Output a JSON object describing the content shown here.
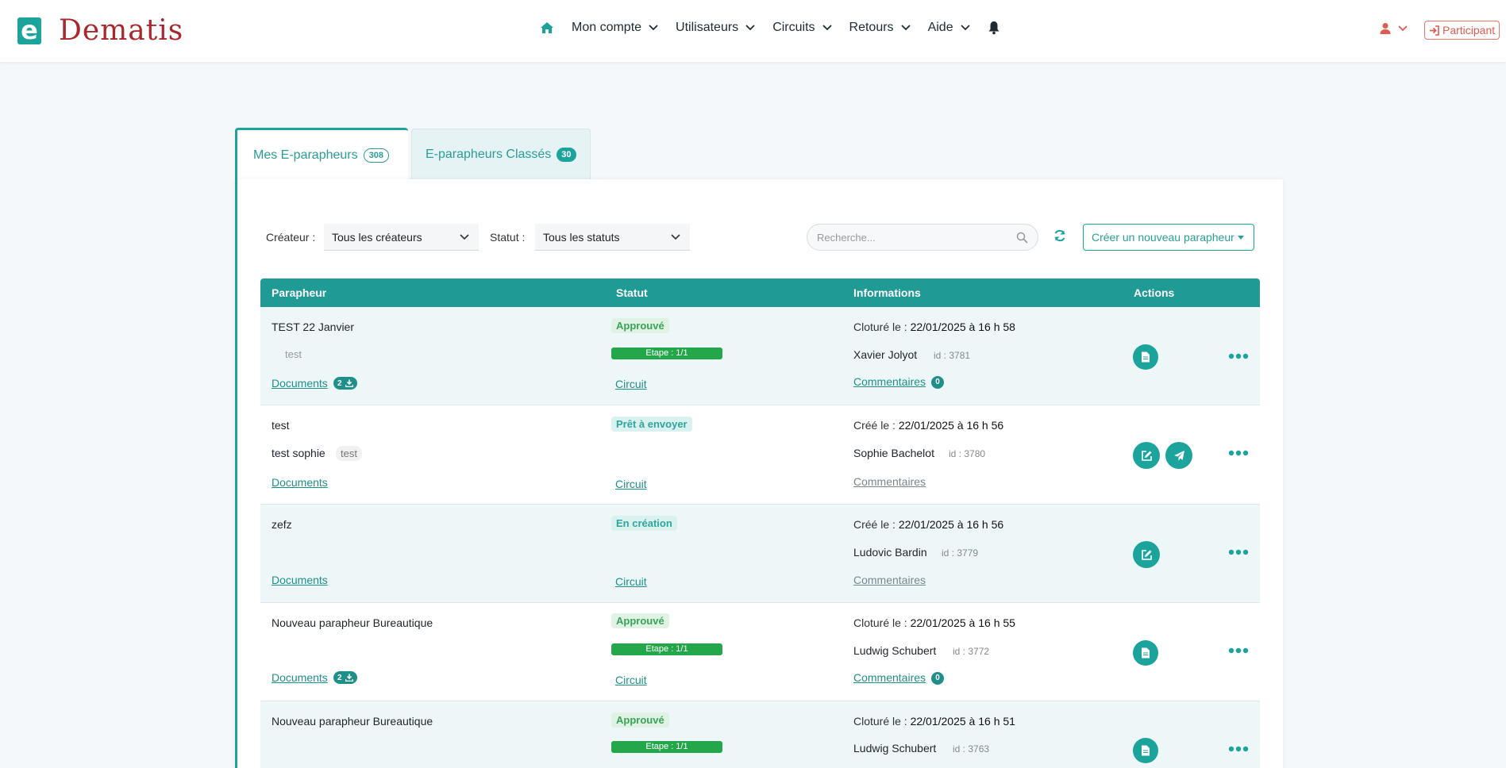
{
  "brand": {
    "logo_letter": "e",
    "name": "Dematis",
    "colors": {
      "primary": "#1ba39c",
      "brand_red": "#a8282e",
      "accent_orange": "#e05a4f"
    }
  },
  "nav": {
    "home_icon": "home-icon",
    "items": [
      {
        "label": "Mon compte"
      },
      {
        "label": "Utilisateurs"
      },
      {
        "label": "Circuits"
      },
      {
        "label": "Retours"
      },
      {
        "label": "Aide"
      }
    ],
    "bell_icon": "bell-icon",
    "user_icon": "user-icon",
    "participant_label": "Participant"
  },
  "tabs": [
    {
      "label": "Mes E-parapheurs",
      "count": "308",
      "active": true
    },
    {
      "label": "E-parapheurs Classés",
      "count": "30",
      "active": false
    }
  ],
  "filters": {
    "creator_label": "Créateur :",
    "creator_value": "Tous les créateurs",
    "status_label": "Statut :",
    "status_value": "Tous les statuts",
    "search_placeholder": "Recherche...",
    "create_button": "Créer un nouveau parapheur"
  },
  "table": {
    "headers": {
      "parapheur": "Parapheur",
      "statut": "Statut",
      "informations": "Informations",
      "actions": "Actions"
    },
    "rows": [
      {
        "title": "TEST 22 Janvier",
        "subtitle": "",
        "tag": "test",
        "documents": "Documents",
        "doc_count": "2",
        "status": "Approuvé",
        "step": "Etape : 1/1",
        "circuit": "Circuit",
        "info_label": "Cloturé le :",
        "info_date": "22/01/2025 à 16 h 58",
        "person": "Xavier Jolyot",
        "id": "id : 3781",
        "comments": "Commentaires",
        "comment_count": "0"
      },
      {
        "title": "test",
        "subtitle": "test sophie",
        "tag": "test",
        "documents": "Documents",
        "doc_count": "",
        "status": "Prêt à envoyer",
        "step": "",
        "circuit": "Circuit",
        "info_label": "Créé le :",
        "info_date": "22/01/2025 à 16 h 56",
        "person": "Sophie Bachelot",
        "id": "id : 3780",
        "comments": "Commentaires",
        "comment_count": ""
      },
      {
        "title": "zefz",
        "subtitle": "",
        "tag": "",
        "documents": "Documents",
        "doc_count": "",
        "status": "En création",
        "step": "",
        "circuit": "Circuit",
        "info_label": "Créé le :",
        "info_date": "22/01/2025 à 16 h 56",
        "person": "Ludovic Bardin",
        "id": "id : 3779",
        "comments": "Commentaires",
        "comment_count": ""
      },
      {
        "title": "Nouveau parapheur Bureautique",
        "subtitle": "",
        "tag": "",
        "documents": "Documents",
        "doc_count": "2",
        "status": "Approuvé",
        "step": "Etape : 1/1",
        "circuit": "Circuit",
        "info_label": "Cloturé le :",
        "info_date": "22/01/2025 à 16 h 55",
        "person": "Ludwig Schubert",
        "id": "id : 3772",
        "comments": "Commentaires",
        "comment_count": "0"
      },
      {
        "title": "Nouveau parapheur Bureautique",
        "subtitle": "",
        "tag": "",
        "documents": "",
        "doc_count": "",
        "status": "Approuvé",
        "step": "Etape : 1/1",
        "circuit": "",
        "info_label": "Cloturé le :",
        "info_date": "22/01/2025 à 16 h 51",
        "person": "Ludwig Schubert",
        "id": "id : 3763",
        "comments": "",
        "comment_count": ""
      }
    ]
  }
}
